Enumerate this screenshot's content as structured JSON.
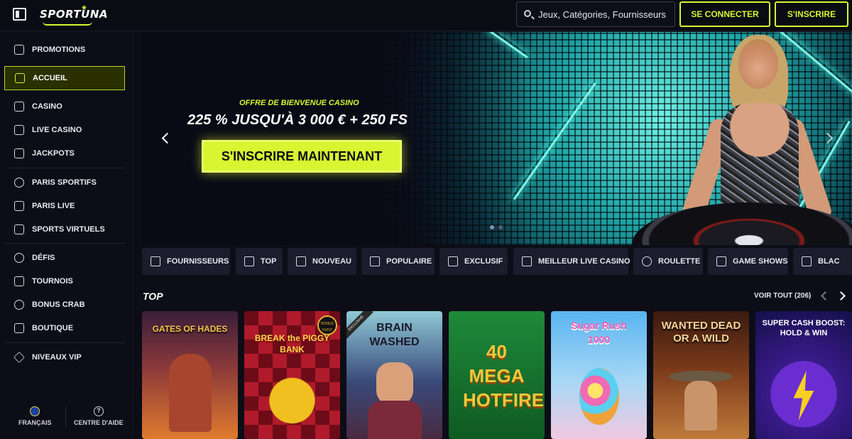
{
  "header": {
    "logo": "SPORTUNA",
    "search_placeholder": "Jeux, Catégories, Fournisseurs",
    "login_label": "SE CONNECTER",
    "signup_label": "S'INSCRIRE"
  },
  "sidebar": {
    "items": [
      {
        "label": "PROMOTIONS",
        "icon": "gift-icon"
      },
      {
        "label": "ACCUEIL",
        "icon": "home-icon",
        "active": true
      },
      {
        "label": "CASINO",
        "icon": "cards-icon"
      },
      {
        "label": "LIVE CASINO",
        "icon": "phone-icon"
      },
      {
        "label": "JACKPOTS",
        "icon": "seven-icon"
      },
      {
        "label": "PARIS SPORTIFS",
        "icon": "football-icon"
      },
      {
        "label": "PARIS LIVE",
        "icon": "video-icon"
      },
      {
        "label": "SPORTS VIRTUELS",
        "icon": "gamepad-icon"
      },
      {
        "label": "DÉFIS",
        "icon": "medal-icon"
      },
      {
        "label": "TOURNOIS",
        "icon": "trophy-icon"
      },
      {
        "label": "BONUS CRAB",
        "icon": "claw-icon"
      },
      {
        "label": "BOUTIQUE",
        "icon": "shop-icon"
      },
      {
        "label": "NIVEAUX VIP",
        "icon": "diamond-icon"
      }
    ],
    "footer": {
      "language_label": "FRANÇAIS",
      "help_label": "CENTRE D'AIDE"
    }
  },
  "hero": {
    "subtitle": "OFFRE DE BIENVENUE CASINO",
    "title": "225 % JUSQU'À 3 000 € + 250 FS",
    "cta_label": "S'INSCRIRE MAINTENANT"
  },
  "categories": [
    {
      "label": "FOURNISSEURS",
      "icon": "layers-icon"
    },
    {
      "label": "TOP",
      "icon": "crown-icon"
    },
    {
      "label": "NOUVEAU",
      "icon": "lightning-icon"
    },
    {
      "label": "POPULAIRE",
      "icon": "flame-icon"
    },
    {
      "label": "EXCLUSIF",
      "icon": "diamond-icon"
    },
    {
      "label": "MEILLEUR LIVE CASINO",
      "icon": "live-icon"
    },
    {
      "label": "ROULETTE",
      "icon": "roulette-icon"
    },
    {
      "label": "GAME SHOWS",
      "icon": "microphone-icon"
    },
    {
      "label": "BLAC",
      "icon": "blackjack-icon"
    }
  ],
  "top_section": {
    "title": "TOP",
    "view_all_label": "VOIR TOUT (206)",
    "games": [
      {
        "title": "GATES OF HADES"
      },
      {
        "title": "BREAK the PIGGY BANK",
        "badge": "BONUS HUNT"
      },
      {
        "title": "BRAIN WASHED",
        "badge": "EXCLUSIVE"
      },
      {
        "title": "40 MEGA HOTFIRE"
      },
      {
        "title": "Sugar Rush 1000"
      },
      {
        "title": "WANTED DEAD OR A WILD"
      },
      {
        "title": "SUPER CASH BOOST: HOLD & WIN"
      }
    ]
  },
  "colors": {
    "accent": "#d7f530",
    "background": "#0d0d17",
    "chip_background": "#1b1c2c"
  }
}
